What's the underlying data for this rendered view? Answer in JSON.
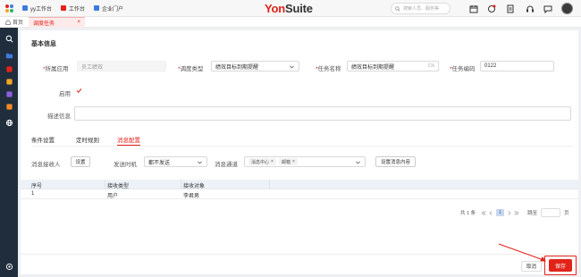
{
  "topbar": {
    "tabs": [
      {
        "label": "yy工作台",
        "color": "#3e7be0"
      },
      {
        "label": "工作台",
        "color": "#e2231a"
      },
      {
        "label": "企业门户",
        "color": "#3e7be0"
      }
    ],
    "brand_yon": "Yon",
    "brand_suite": "Suite",
    "search_placeholder": "搜索人员、服务等"
  },
  "tabbar": {
    "home_label": "首页",
    "active_tab_label": "调度任务",
    "close_glyph": "×"
  },
  "form": {
    "section_title": "基本信息",
    "app_label": "所属应用",
    "app_value": "员工绩效",
    "schedule_type_label": "调度类型",
    "schedule_type_value": "绩效目标到期提醒",
    "task_name_label": "任务名称",
    "task_name_value": "绩效目标到期提醒",
    "task_name_lang": "CN",
    "task_code_label": "任务编码",
    "task_code_value": "0122",
    "enabled_label": "启用",
    "enabled": true,
    "description_label": "描述信息",
    "description_value": "",
    "required_mark": "*"
  },
  "sub_tabs": [
    {
      "label": "条件设置",
      "active": false
    },
    {
      "label": "定时规则",
      "active": false
    },
    {
      "label": "消息配置",
      "active": true
    }
  ],
  "message": {
    "receiver_label": "消息接收人",
    "receiver_button": "设置",
    "send_time_label": "发送时机",
    "send_time_value": "都不发送",
    "channel_label": "消息通道",
    "channel_tags": [
      "消息中心",
      "邮箱"
    ],
    "tag_close": "×",
    "content_button": "设置消息内容"
  },
  "table": {
    "headers": [
      "序号",
      "接收类型",
      "接收对象"
    ],
    "rows": [
      [
        "1",
        "用户",
        "李君男"
      ]
    ]
  },
  "pager": {
    "total_prefix": "共",
    "total": "1",
    "total_suffix": "条",
    "current_page": "1",
    "jump_label": "跳至",
    "page_suffix": "页"
  },
  "footer": {
    "cancel_label": "取消",
    "save_label": "保存"
  },
  "colors": {
    "accent": "#e2231a",
    "sidebar": "#1f2d3d",
    "table_header": "#edf2f8"
  }
}
